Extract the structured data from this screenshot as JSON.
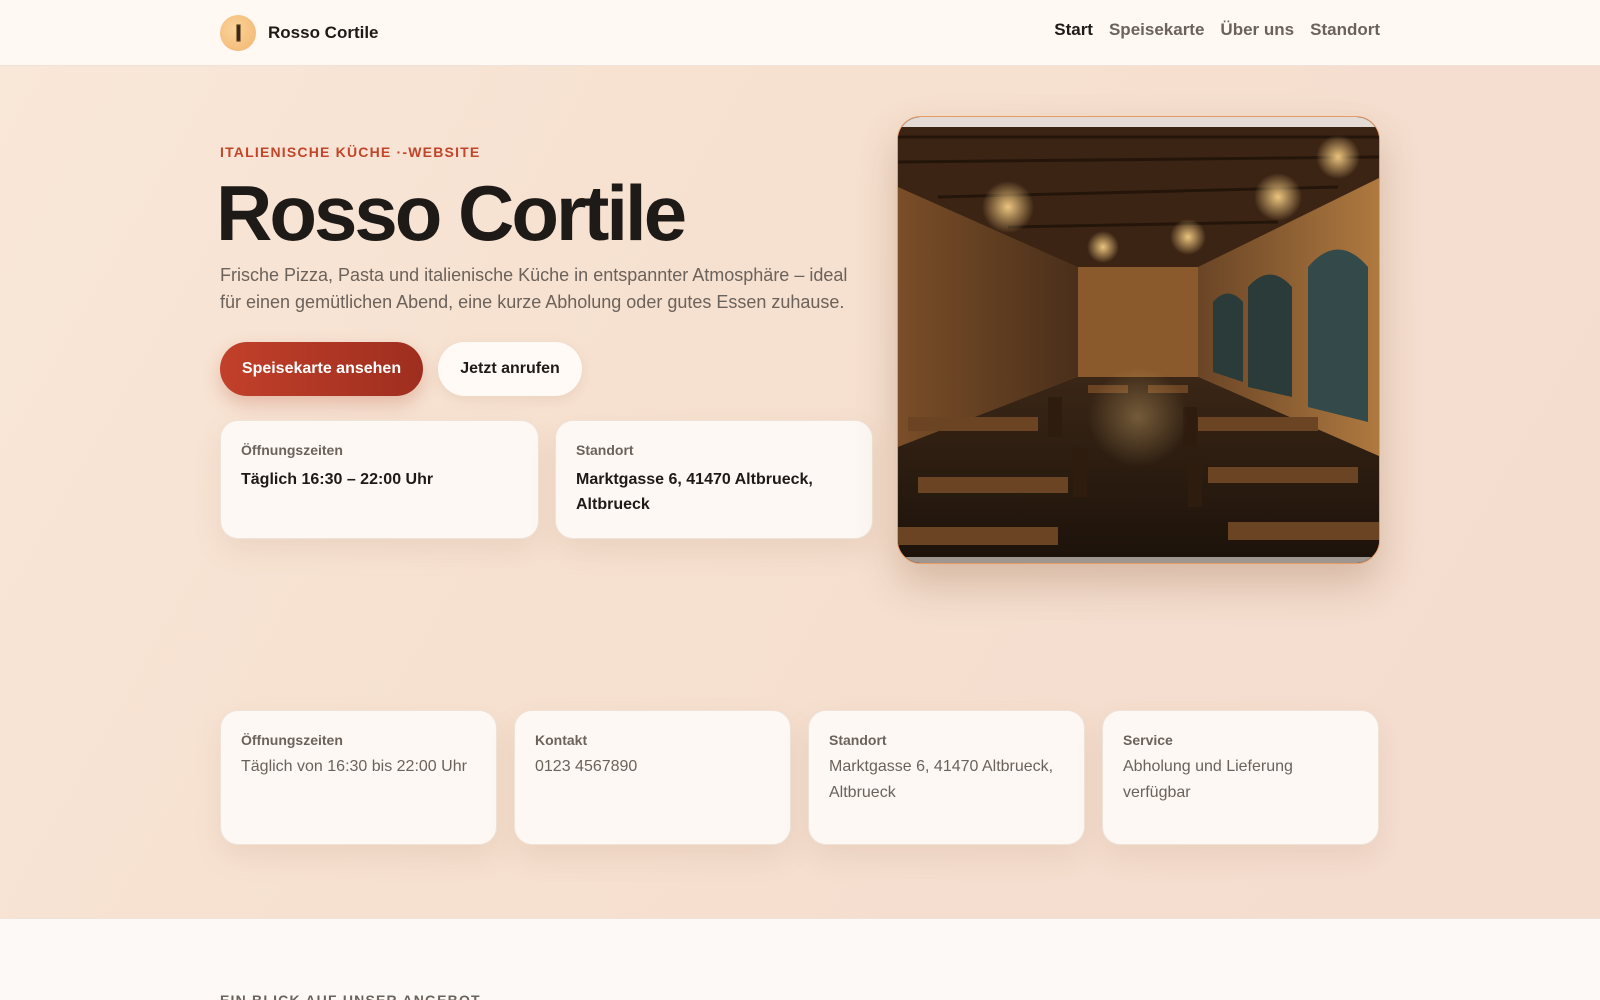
{
  "header": {
    "brand_name": "Rosso Cortile",
    "nav": [
      {
        "label": "Start",
        "active": true
      },
      {
        "label": "Speisekarte",
        "active": false
      },
      {
        "label": "Über uns",
        "active": false
      },
      {
        "label": "Standort",
        "active": false
      }
    ]
  },
  "hero": {
    "eyebrow": "Italienische Küche ·-Website",
    "title": "Rosso Cortile",
    "lead": "Frische Pizza, Pasta und italienische Küche in entspannter Atmosphäre – ideal für einen gemütlichen Abend, eine kurze Abholung oder gutes Essen zuhause.",
    "primary_button": "Speisekarte ansehen",
    "secondary_button": "Jetzt anrufen",
    "cards": [
      {
        "label": "Öffnungszeiten",
        "value": "Täglich 16:30 – 22:00 Uhr"
      },
      {
        "label": "Standort",
        "value": "Marktgasse 6, 41470 Altbrueck, Altbrueck"
      }
    ]
  },
  "info_cards": [
    {
      "label": "Öffnungszeiten",
      "value": "Täglich von 16:30 bis 22:00 Uhr"
    },
    {
      "label": "Kontakt",
      "value": "0123 4567890"
    },
    {
      "label": "Standort",
      "value": "Marktgasse 6, 41470 Altbrueck, Altbrueck"
    },
    {
      "label": "Service",
      "value": "Abholung und Lieferung verfügbar"
    }
  ],
  "section": {
    "eyebrow": "Ein Blick auf unser Angebot"
  },
  "colors": {
    "accent": "#c2452b",
    "button_primary": "#b0361f",
    "text_dark": "#1e1a17",
    "text_muted": "#6b625b"
  }
}
